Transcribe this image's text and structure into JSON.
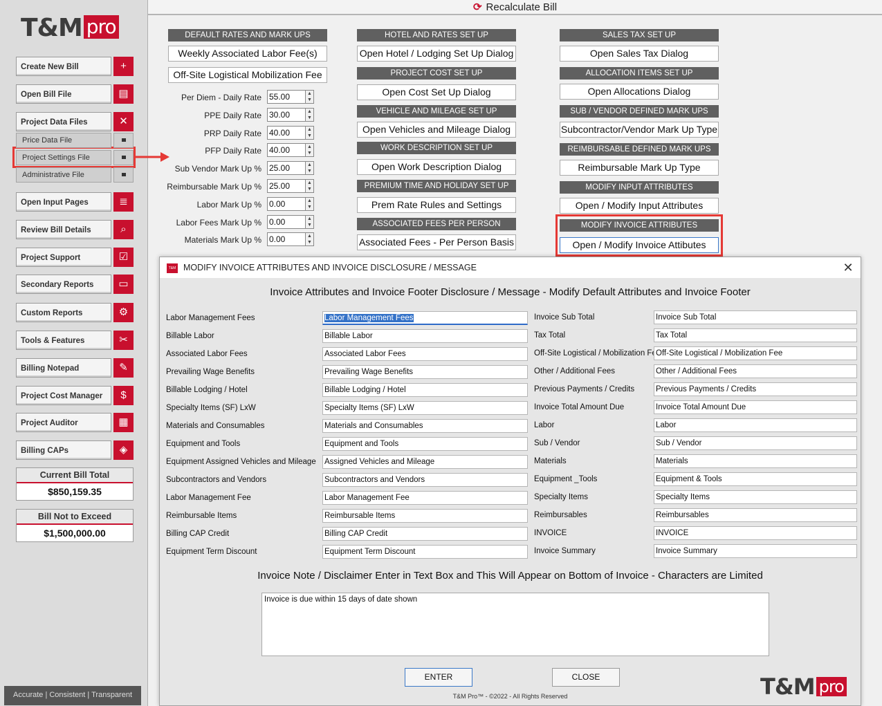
{
  "logo": {
    "tm": "T&M",
    "pro": "pro"
  },
  "sidebar": {
    "buttons": [
      {
        "label": "Create New Bill",
        "icon": "+"
      },
      {
        "label": "Open Bill File",
        "icon": "▤"
      },
      {
        "label": "Project Data Files",
        "icon": "✕"
      },
      {
        "label": "Open Input Pages",
        "icon": "≣"
      },
      {
        "label": "Review Bill Details",
        "icon": "⌕"
      },
      {
        "label": "Project Support",
        "icon": "☑"
      },
      {
        "label": "Secondary Reports",
        "icon": "▭"
      },
      {
        "label": "Custom Reports",
        "icon": "⚙"
      },
      {
        "label": "Tools & Features",
        "icon": "✂"
      },
      {
        "label": "Billing Notepad",
        "icon": "✎"
      },
      {
        "label": "Project Cost Manager",
        "icon": "$"
      },
      {
        "label": "Project Auditor",
        "icon": "▦"
      },
      {
        "label": "Billing CAPs",
        "icon": "◈"
      }
    ],
    "subitems": [
      "Price Data File",
      "Project Settings File",
      "Administrative File"
    ],
    "current_total_label": "Current Bill Total",
    "current_total_value": "$850,159.35",
    "nte_label": "Bill Not to Exceed",
    "nte_value": "$1,500,000.00",
    "tagline": "Accurate | Consistent | Transparent"
  },
  "topbar": {
    "icon": "⟳",
    "label": "Recalculate Bill"
  },
  "col1": {
    "header": "DEFAULT RATES AND MARK UPS",
    "btn1": "Weekly Associated  Labor Fee(s)",
    "btn2": "Off-Site Logistical Mobilization Fee",
    "rates": [
      {
        "label": "Per Diem - Daily Rate",
        "value": "55.00"
      },
      {
        "label": "PPE Daily Rate",
        "value": "30.00"
      },
      {
        "label": "PRP Daily Rate",
        "value": "40.00"
      },
      {
        "label": "PFP Daily Rate",
        "value": "40.00"
      },
      {
        "label": "Sub Vendor Mark Up %",
        "value": "25.00"
      },
      {
        "label": "Reimbursable Mark Up %",
        "value": "25.00"
      },
      {
        "label": "Labor Mark Up  %",
        "value": "0.00"
      },
      {
        "label": "Labor Fees Mark Up  %",
        "value": "0.00"
      },
      {
        "label": "Materials Mark Up  %",
        "value": "0.00"
      }
    ]
  },
  "col2": {
    "items": [
      {
        "header": "HOTEL AND RATES SET UP",
        "button": "Open Hotel / Lodging Set Up Dialog"
      },
      {
        "header": "PROJECT COST SET UP",
        "button": "Open Cost Set Up Dialog"
      },
      {
        "header": "VEHICLE AND MILEAGE SET UP",
        "button": "Open Vehicles and Mileage Dialog"
      },
      {
        "header": "WORK DESCRIPTION SET UP",
        "button": "Open Work Description Dialog"
      },
      {
        "header": "PREMIUM TIME AND HOLIDAY SET UP",
        "button": "Prem Rate Rules and Settings"
      },
      {
        "header": "ASSOCIATED FEES PER PERSON",
        "button": "Associated Fees  - Per Person Basis"
      }
    ]
  },
  "col3": {
    "items": [
      {
        "header": "SALES TAX SET UP",
        "button": "Open Sales Tax Dialog"
      },
      {
        "header": "ALLOCATION ITEMS SET UP",
        "button": "Open Allocations Dialog"
      },
      {
        "header": "SUB / VENDOR DEFINED MARK UPS",
        "button": "Subcontractor/Vendor Mark Up Type"
      },
      {
        "header": "REIMBURSABLE DEFINED MARK UPS",
        "button": "Reimbursable Mark Up Type"
      },
      {
        "header": "MODIFY INPUT ATTRIBUTES",
        "button": "Open / Modify Input Attributes"
      },
      {
        "header": "MODIFY INVOICE ATTRIBUTES",
        "button": "Open / Modify  Invoice Attibutes"
      }
    ]
  },
  "modal": {
    "title": "MODIFY INVOICE ATTRIBUTES AND INVOICE DISCLOSURE / MESSAGE",
    "icon_text": "T&M",
    "close": "✕",
    "heading": "Invoice Attributes and Invoice Footer Disclosure  / Message - Modify Default Attributes and Invoice Footer",
    "left_fields": [
      {
        "label": "Labor Management Fees",
        "value": "Labor Management Fees"
      },
      {
        "label": "Billable Labor",
        "value": "Billable Labor"
      },
      {
        "label": "Associated Labor Fees",
        "value": "Associated Labor Fees"
      },
      {
        "label": "Prevailing Wage Benefits",
        "value": "Prevailing Wage Benefits"
      },
      {
        "label": "Billable Lodging / Hotel",
        "value": "Billable Lodging / Hotel"
      },
      {
        "label": "Specialty Items (SF) LxW",
        "value": "Specialty Items (SF) LxW"
      },
      {
        "label": "Materials and Consumables",
        "value": "Materials and Consumables"
      },
      {
        "label": "Equipment and Tools",
        "value": "Equipment and Tools"
      },
      {
        "label": "Equipment Assigned Vehicles and Mileage",
        "value": "Assigned Vehicles and Mileage"
      },
      {
        "label": "Subcontractors and Vendors",
        "value": "Subcontractors and Vendors"
      },
      {
        "label": "Labor Management Fee",
        "value": "Labor Management Fee"
      },
      {
        "label": "Reimbursable Items",
        "value": "Reimbursable Items"
      },
      {
        "label": "Billing CAP Credit",
        "value": "Billing CAP Credit"
      },
      {
        "label": "Equipment Term Discount",
        "value": "Equipment Term Discount"
      }
    ],
    "right_fields": [
      {
        "label": "Invoice Sub Total",
        "value": "Invoice Sub Total"
      },
      {
        "label": "Tax Total",
        "value": "Tax Total"
      },
      {
        "label": "Off-Site Logistical / Mobilization Fee",
        "value": "Off-Site Logistical / Mobilization Fee"
      },
      {
        "label": "Other / Additional Fees",
        "value": "Other / Additional Fees"
      },
      {
        "label": "Previous Payments / Credits",
        "value": "Previous Payments / Credits"
      },
      {
        "label": "Invoice Total Amount Due",
        "value": "Invoice Total Amount Due"
      },
      {
        "label": "Labor",
        "value": "Labor"
      },
      {
        "label": "Sub / Vendor",
        "value": "Sub / Vendor"
      },
      {
        "label": "Materials",
        "value": "Materials"
      },
      {
        "label": "Equipment _Tools",
        "value": "Equipment & Tools"
      },
      {
        "label": "Specialty Items",
        "value": "Specialty Items"
      },
      {
        "label": "Reimbursables",
        "value": "Reimbursables"
      },
      {
        "label": "INVOICE",
        "value": "INVOICE"
      },
      {
        "label": "Invoice Summary",
        "value": "Invoice Summary"
      }
    ],
    "note_heading": "Invoice Note / Disclaimer Enter in Text Box and This Will Appear on Bottom of  Invoice - Characters are Limited",
    "note_text": "Invoice is due within 15 days of date shown",
    "enter": "ENTER",
    "close_btn": "CLOSE",
    "copyright": "T&M Pro™ - ©2022 - All Rights Reserved"
  }
}
